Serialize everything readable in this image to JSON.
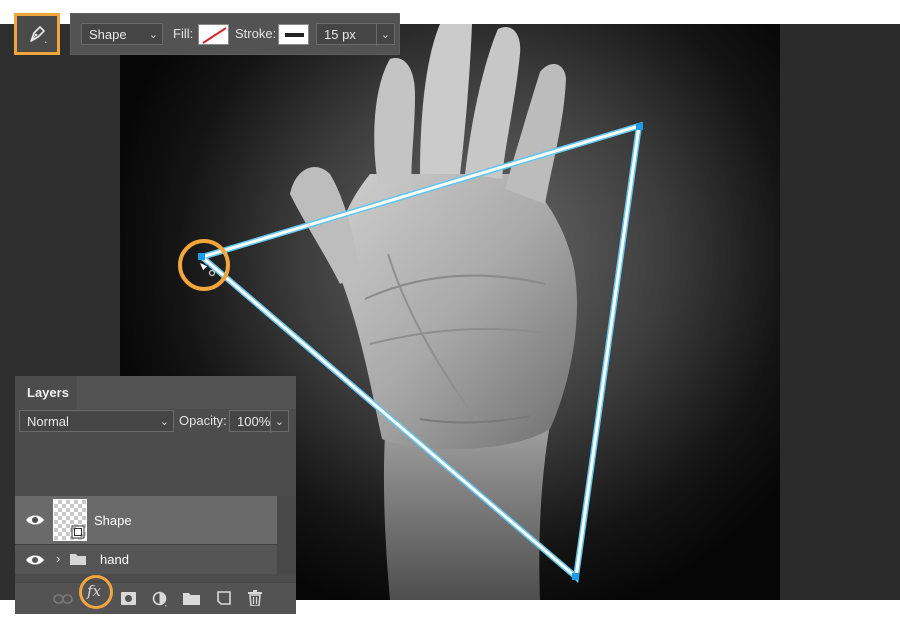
{
  "options_bar": {
    "tool_mode": "Shape",
    "fill_label": "Fill:",
    "stroke_label": "Stroke:",
    "stroke_width": "15 px"
  },
  "layers_panel": {
    "tab_label": "Layers",
    "blend_mode": "Normal",
    "opacity_label": "Opacity:",
    "opacity_value": "100%",
    "layers": [
      {
        "name": "Shape",
        "type": "shape",
        "selected": true,
        "visible": true
      },
      {
        "name": "hand",
        "type": "group",
        "selected": false,
        "visible": true
      }
    ],
    "footer_icons": [
      "link-icon",
      "fx-icon",
      "mask-icon",
      "adjustment-icon",
      "folder-icon",
      "new-layer-icon",
      "trash-icon"
    ]
  },
  "colors": {
    "highlight": "#f1a53d",
    "path_stroke": "#ffffff",
    "path_outline": "#5fc6ee",
    "anchor": "#1e9be6",
    "panel": "#535353"
  }
}
